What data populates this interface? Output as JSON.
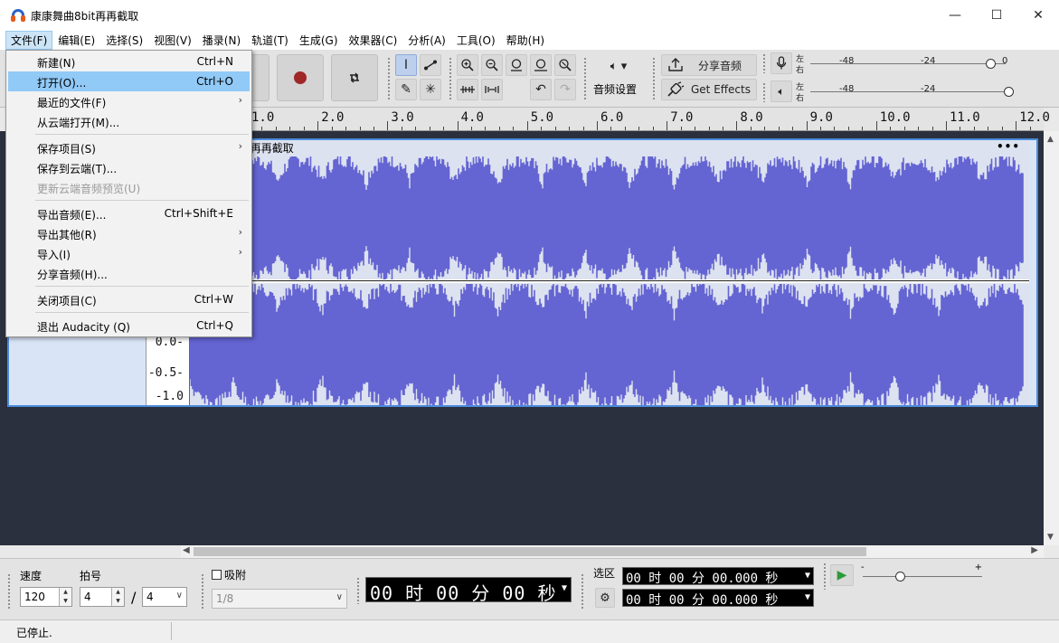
{
  "window": {
    "title": "康康舞曲8bit再再截取",
    "controls": {
      "minimize": "—",
      "maximize": "☐",
      "close": "✕"
    }
  },
  "menubar": {
    "items": [
      "文件(F)",
      "编辑(E)",
      "选择(S)",
      "视图(V)",
      "播录(N)",
      "轨道(T)",
      "生成(G)",
      "效果器(C)",
      "分析(A)",
      "工具(O)",
      "帮助(H)"
    ],
    "active": "文件(F)"
  },
  "file_menu": {
    "items": [
      {
        "label": "新建(N)",
        "shortcut": "Ctrl+N"
      },
      {
        "label": "打开(O)...",
        "shortcut": "Ctrl+O",
        "highlighted": true
      },
      {
        "label": "最近的文件(F)",
        "submenu": true
      },
      {
        "label": "从云端打开(M)..."
      },
      {
        "label": "保存项目(S)",
        "submenu": true
      },
      {
        "label": "保存到云端(T)..."
      },
      {
        "label": "更新云端音频预览(U)",
        "disabled": true
      },
      {
        "label": "导出音频(E)...",
        "shortcut": "Ctrl+Shift+E"
      },
      {
        "label": "导出其他(R)",
        "submenu": true
      },
      {
        "label": "导入(I)",
        "submenu": true
      },
      {
        "label": "分享音频(H)..."
      },
      {
        "label": "关闭项目(C)",
        "shortcut": "Ctrl+W"
      },
      {
        "label": "退出 Audacity (Q)",
        "shortcut": "Ctrl+Q"
      }
    ],
    "submenu_arrow": "›"
  },
  "toolbar": {
    "audio_setup": "音频设置",
    "share_audio": "分享音频",
    "get_effects": "Get Effects",
    "record_meter": {
      "left": "左",
      "right": "右",
      "ticks": [
        "-48",
        "-24",
        "0"
      ]
    },
    "play_meter": {
      "left": "左",
      "right": "右",
      "ticks": [
        "-48",
        "-24"
      ]
    }
  },
  "ruler": {
    "labels": [
      "1.0",
      "2.0",
      "3.0",
      "4.0",
      "5.0",
      "6.0",
      "7.0",
      "8.0",
      "9.0",
      "10.0",
      "11.0",
      "12.0"
    ]
  },
  "track": {
    "clip_name": "t再再截取",
    "clip_menu": "•••",
    "amplitude_labels": [
      "0.0-",
      "-0.5-",
      "-1.0"
    ]
  },
  "bottom": {
    "tempo_label": "速度",
    "tempo_value": "120",
    "time_sig_label": "拍号",
    "time_sig_num": "4",
    "time_sig_slash": "/",
    "time_sig_den": "4",
    "snap_label": "吸附",
    "snap_value": "1/8",
    "time_display": "00 时 00 分 00 秒",
    "selection_label": "选区",
    "sel_start": "00 时 00 分 00.000 秒",
    "sel_end": "00 时 00 分 00.000 秒",
    "speed_min": "-",
    "speed_max": "+"
  },
  "status": {
    "text": "已停止."
  },
  "colors": {
    "waveform": "#6464d2",
    "track_bg": "#2a303d",
    "menu_highlight": "#91c9f7",
    "selection_border": "#4a8bdc"
  }
}
